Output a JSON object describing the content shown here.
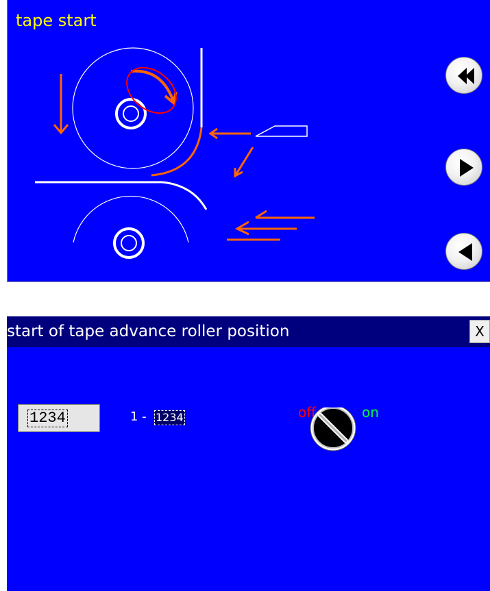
{
  "diagram_panel": {
    "title": "tape start",
    "colors": {
      "background": "#0000ff",
      "title": "#ffff00",
      "arrow": "#ff6600",
      "highlight": "#ff0000",
      "line": "#ffffff"
    },
    "buttons": [
      {
        "name": "rewind-button",
        "icon": "double-left-chevron-icon"
      },
      {
        "name": "play-forward-button",
        "icon": "right-triangle-icon"
      },
      {
        "name": "play-backward-button",
        "icon": "left-triangle-icon"
      }
    ]
  },
  "dialog": {
    "title": "start of tape advance roller position",
    "close_label": "X",
    "value_field": {
      "value": "1234"
    },
    "range": {
      "prefix": "1 -",
      "max": "1234"
    },
    "switch": {
      "off_label": "off",
      "on_label": "on",
      "state": "off"
    },
    "colors": {
      "titlebar": "#00007e",
      "background": "#0000ff",
      "off": "#ff0000",
      "on": "#00ff40"
    }
  }
}
